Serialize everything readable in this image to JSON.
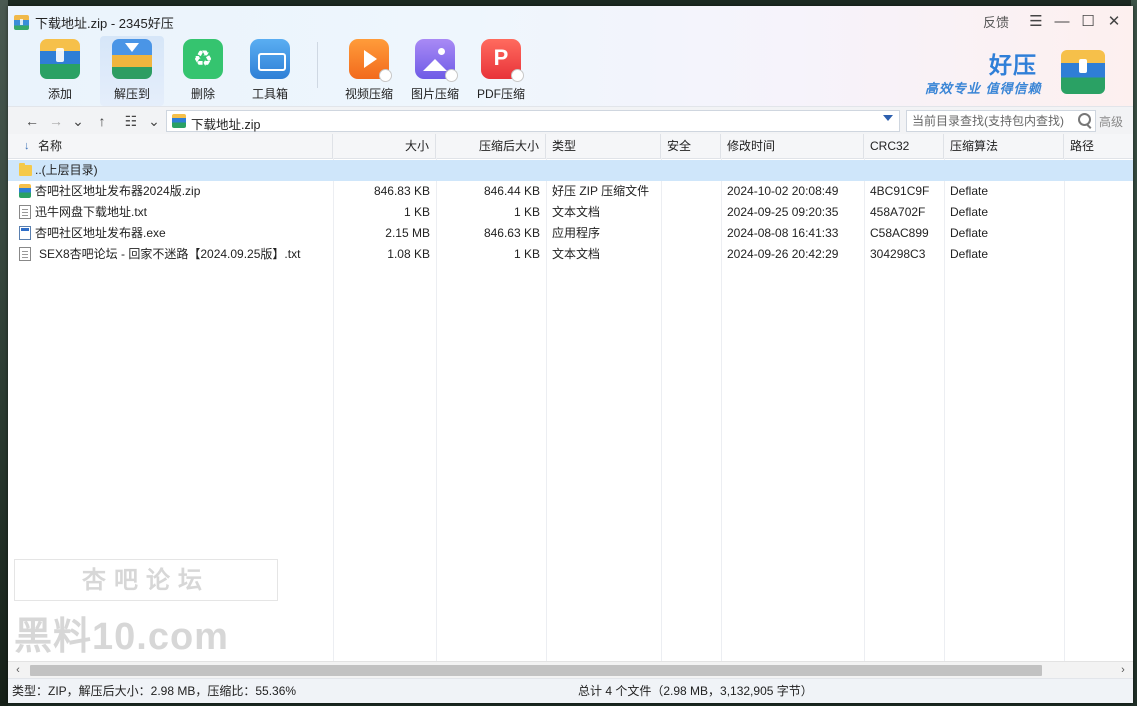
{
  "window": {
    "title": "下载地址.zip - 2345好压",
    "feedback": "反馈"
  },
  "toolbar": {
    "items": [
      {
        "label": "添加",
        "icon": "add-box-icon"
      },
      {
        "label": "解压到",
        "icon": "extract-icon"
      },
      {
        "label": "删除",
        "icon": "recycle-icon"
      },
      {
        "label": "工具箱",
        "icon": "toolbox-icon"
      },
      {
        "label": "视频压缩",
        "icon": "video-compress-icon"
      },
      {
        "label": "图片压缩",
        "icon": "image-compress-icon"
      },
      {
        "label": "PDF压缩",
        "icon": "pdf-compress-icon"
      }
    ]
  },
  "brand": {
    "name": "好压",
    "slogan": "高效专业 值得信赖"
  },
  "address": {
    "path": "下载地址.zip",
    "search_placeholder": "当前目录查找(支持包内查找)",
    "advanced": "高级"
  },
  "columns": [
    "名称",
    "大小",
    "压缩后大小",
    "类型",
    "安全",
    "修改时间",
    "CRC32",
    "压缩算法",
    "路径"
  ],
  "rows": [
    {
      "name": "..(上层目录)",
      "size": "",
      "packed": "",
      "type": "",
      "safe": "",
      "mtime": "",
      "crc": "",
      "method": "",
      "path": "",
      "icon": "folder"
    },
    {
      "name": "杏吧社区地址发布器2024版.zip",
      "size": "846.83 KB",
      "packed": "846.44 KB",
      "type": "好压 ZIP 压缩文件",
      "safe": "",
      "mtime": "2024-10-02 20:08:49",
      "crc": "4BC91C9F",
      "method": "Deflate",
      "path": "",
      "icon": "zip"
    },
    {
      "name": "迅牛网盘下载地址.txt",
      "size": "1 KB",
      "packed": "1 KB",
      "type": "文本文档",
      "safe": "",
      "mtime": "2024-09-25 09:20:35",
      "crc": "458A702F",
      "method": "Deflate",
      "path": "",
      "icon": "txt"
    },
    {
      "name": "杏吧社区地址发布器.exe",
      "size": "2.15 MB",
      "packed": "846.63 KB",
      "type": "应用程序",
      "safe": "",
      "mtime": "2024-08-08 16:41:33",
      "crc": "C58AC899",
      "method": "Deflate",
      "path": "",
      "icon": "exe"
    },
    {
      "name": "SEX8杏吧论坛 - 回家不迷路【2024.09.25版】.txt",
      "size": "1.08 KB",
      "packed": "1 KB",
      "type": "文本文档",
      "safe": "",
      "mtime": "2024-09-26 20:42:29",
      "crc": "304298C3",
      "method": "Deflate",
      "path": "",
      "icon": "txt"
    }
  ],
  "watermark": {
    "line1": "杏吧论坛",
    "line2": "黑料10.com"
  },
  "status": {
    "left": "类型：ZIP，解压后大小：2.98 MB，压缩比：55.36%",
    "right": "总计 4 个文件（2.98 MB，3,132,905 字节）"
  }
}
